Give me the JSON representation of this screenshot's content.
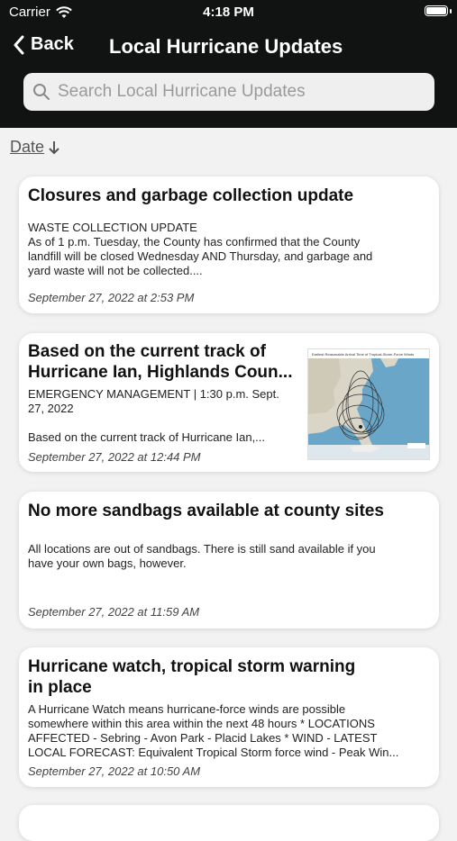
{
  "status": {
    "carrier": "Carrier",
    "time": "4:18 PM"
  },
  "nav": {
    "back_label": "Back",
    "title": "Local Hurricane Updates"
  },
  "search": {
    "placeholder": "Search Local Hurricane Updates",
    "value": ""
  },
  "sort": {
    "label": "Date"
  },
  "articles": [
    {
      "title": "Closures and garbage collection update",
      "lines": [
        "WASTE COLLECTION UPDATE",
        "As of 1 p.m. Tuesday, the County has confirmed that the County",
        "landfill will be closed Wednesday AND Thursday, and garbage and",
        "yard waste will not be collected...."
      ],
      "date": "September 27, 2022 at 2:53 PM"
    },
    {
      "title_lines": [
        "Based on the current track of",
        "Hurricane Ian, Highlands Coun..."
      ],
      "lines": [
        "EMERGENCY MANAGEMENT | 1:30 p.m. Sept.",
        "27, 2022",
        "",
        "Based on the current track of Hurricane Ian,..."
      ],
      "date": "September 27, 2022 at 12:44 PM",
      "thumbnail_caption": "Earliest Reasonable Arrival Time of Tropical-Storm-Force Winds"
    },
    {
      "title": "No more sandbags available at county sites",
      "lines": [
        "All locations are out of sandbags. There is still sand available if you",
        "have your own bags, however."
      ],
      "date": "September 27, 2022 at 11:59 AM"
    },
    {
      "title_lines": [
        "Hurricane watch, tropical storm warning",
        "in place"
      ],
      "lines": [
        "A Hurricane Watch means hurricane-force winds are possible",
        "somewhere within this area within the next 48 hours * LOCATIONS",
        "AFFECTED - Sebring - Avon Park - Placid Lakes * WIND - LATEST",
        "LOCAL FORECAST: Equivalent Tropical Storm force wind - Peak Win..."
      ],
      "date": "September 27, 2022 at 10:50 AM"
    }
  ]
}
